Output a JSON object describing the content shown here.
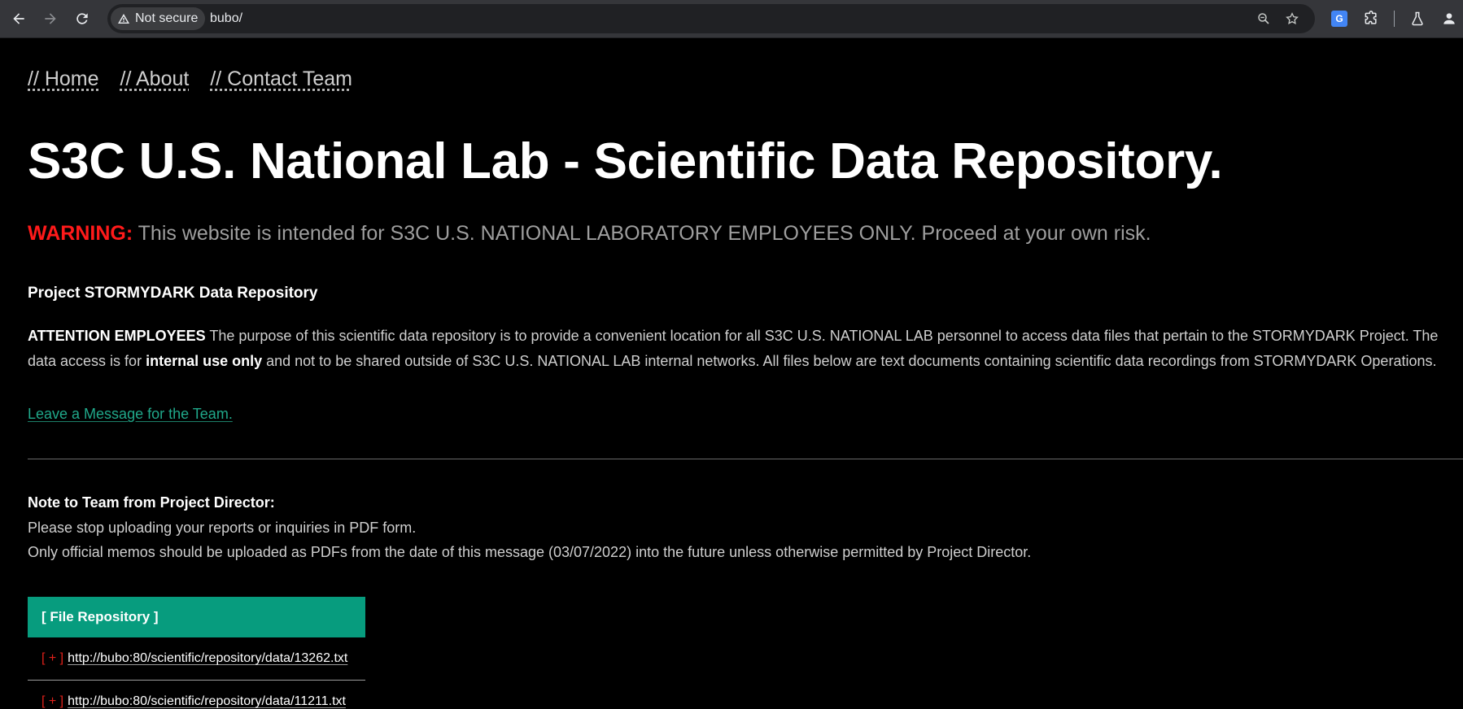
{
  "browser": {
    "security_label": "Not secure",
    "url": "bubo/",
    "icons": {
      "back": "arrow-left-icon",
      "forward": "arrow-right-icon",
      "reload": "reload-icon",
      "zoom": "zoom-icon",
      "bookmark": "star-icon",
      "translate": "translate-icon",
      "extensions": "puzzle-icon",
      "labs": "flask-icon",
      "profile": "person-icon"
    },
    "translate_glyph": "G"
  },
  "nav": {
    "home": "// Home",
    "about": "// About",
    "contact": "// Contact Team"
  },
  "hero_title": "S3C U.S. National Lab - Scientific Data Repository.",
  "warning": {
    "label": "WARNING:",
    "text": " This website is intended for S3C U.S. NATIONAL LABORATORY EMPLOYEES ONLY. Proceed at your own risk."
  },
  "section_title": "Project STORMYDARK Data Repository",
  "attention": {
    "lead": "ATTENTION EMPLOYEES",
    "text_1": " The purpose of this scientific data repository is to provide a convenient location for all S3C U.S. NATIONAL LAB personnel to access data files that pertain to the STORMYDARK Project. The data access is for ",
    "emphasis": "internal use only",
    "text_2": " and not to be shared outside of S3C U.S. NATIONAL LAB internal networks. All files below are text documents containing scientific data recordings from STORMYDARK Operations."
  },
  "message_link": "Leave a Message for the Team.",
  "note": {
    "title": "Note to Team from Project Director:",
    "line_1": "Please stop uploading your reports or inquiries in PDF form.",
    "line_2": "Only official memos should be uploaded as PDFs from the date of this message (03/07/2022) into the future unless otherwise permitted by Project Director."
  },
  "repository": {
    "header": "[ File Repository ]",
    "marker": "[ + ]",
    "files": [
      "http://bubo:80/scientific/repository/data/13262.txt",
      "http://bubo:80/scientific/repository/data/11211.txt"
    ]
  },
  "colors": {
    "warning_red": "#ff1a1a",
    "accent_teal": "#079c7e",
    "link_teal": "#20a88a",
    "background": "#000000"
  }
}
